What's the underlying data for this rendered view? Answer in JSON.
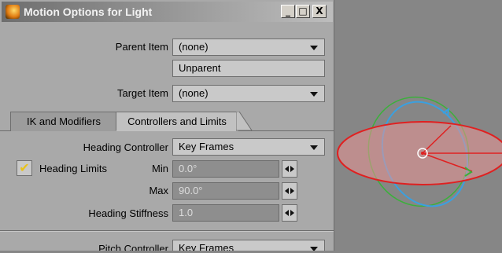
{
  "window": {
    "title": "Motion Options for Light",
    "minimize_glyph": "_",
    "maximize_glyph": "□",
    "close_glyph": "X"
  },
  "parent": {
    "label": "Parent Item",
    "value": "(none)",
    "unparent_label": "Unparent"
  },
  "target": {
    "label": "Target Item",
    "value": "(none)"
  },
  "tabs": [
    {
      "label": "IK and Modifiers",
      "active": false
    },
    {
      "label": "Controllers and Limits",
      "active": true
    }
  ],
  "heading": {
    "controller_label": "Heading Controller",
    "controller_value": "Key Frames",
    "limits_label": "Heading Limits",
    "limits_checked": true,
    "check_glyph": "✔",
    "min_label": "Min",
    "min_value": "0.0°",
    "max_label": "Max",
    "max_value": "90.0°",
    "stiffness_label": "Heading Stiffness",
    "stiffness_value": "1.0"
  },
  "pitch": {
    "controller_label": "Pitch Controller",
    "controller_value": "Key Frames"
  },
  "icons": {
    "app": "lightwave-app-icon",
    "dropdown": "chevron-down-icon",
    "spinner": "left-right-arrows-icon",
    "viewport_gizmo": "rotation-gizmo-icon"
  },
  "colors": {
    "panel_bg": "#a9a9a9",
    "viewport_bg": "#868686",
    "field_bg": "#c9c9c9",
    "numeric_bg": "#8e8e8e",
    "check": "#e8c21a",
    "heading_ring": "#e02020",
    "pitch_ring": "#3aa0e0",
    "bank_ring": "#3bb03b"
  }
}
